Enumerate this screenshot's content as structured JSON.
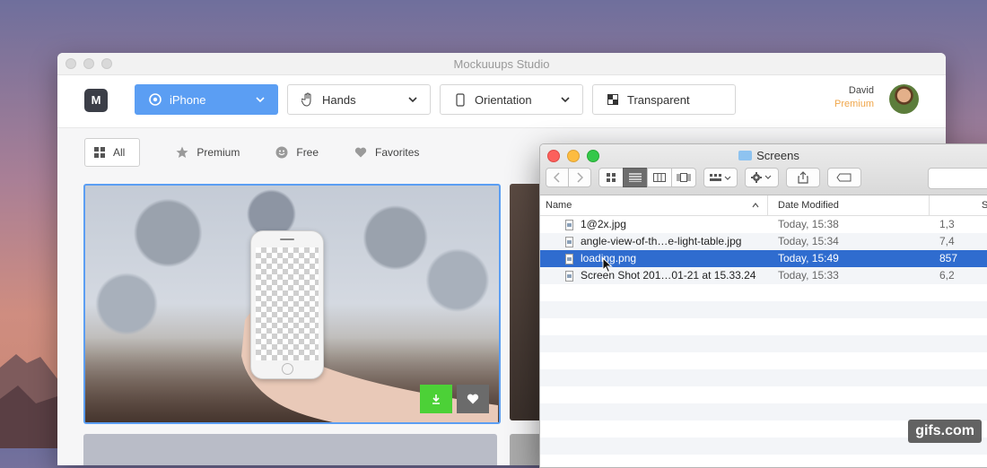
{
  "app": {
    "title": "Mockuuups Studio",
    "logo": "M",
    "toolbar": {
      "device": "iPhone",
      "hands": "Hands",
      "orientation": "Orientation",
      "background": "Transparent"
    },
    "user": {
      "name": "David",
      "tier": "Premium"
    },
    "filters": [
      "All",
      "Premium",
      "Free",
      "Favorites"
    ],
    "colors": {
      "accent": "#5b9ef3",
      "download": "#4cd137",
      "premium": "#f0a64a"
    }
  },
  "finder": {
    "title": "Screens",
    "columns": {
      "name": "Name",
      "date": "Date Modified",
      "size": "S"
    },
    "files": [
      {
        "name": "1@2x.jpg",
        "date": "Today, 15:38",
        "size": "1,3"
      },
      {
        "name": "angle-view-of-th…e-light-table.jpg",
        "date": "Today, 15:34",
        "size": "7,4"
      },
      {
        "name": "loading.png",
        "date": "Today, 15:49",
        "size": "857",
        "selected": true
      },
      {
        "name": "Screen Shot 201…01-21 at 15.33.24",
        "date": "Today, 15:33",
        "size": "6,2"
      }
    ],
    "selection_color": "#2f6ccf"
  },
  "watermark": "gifs.com"
}
